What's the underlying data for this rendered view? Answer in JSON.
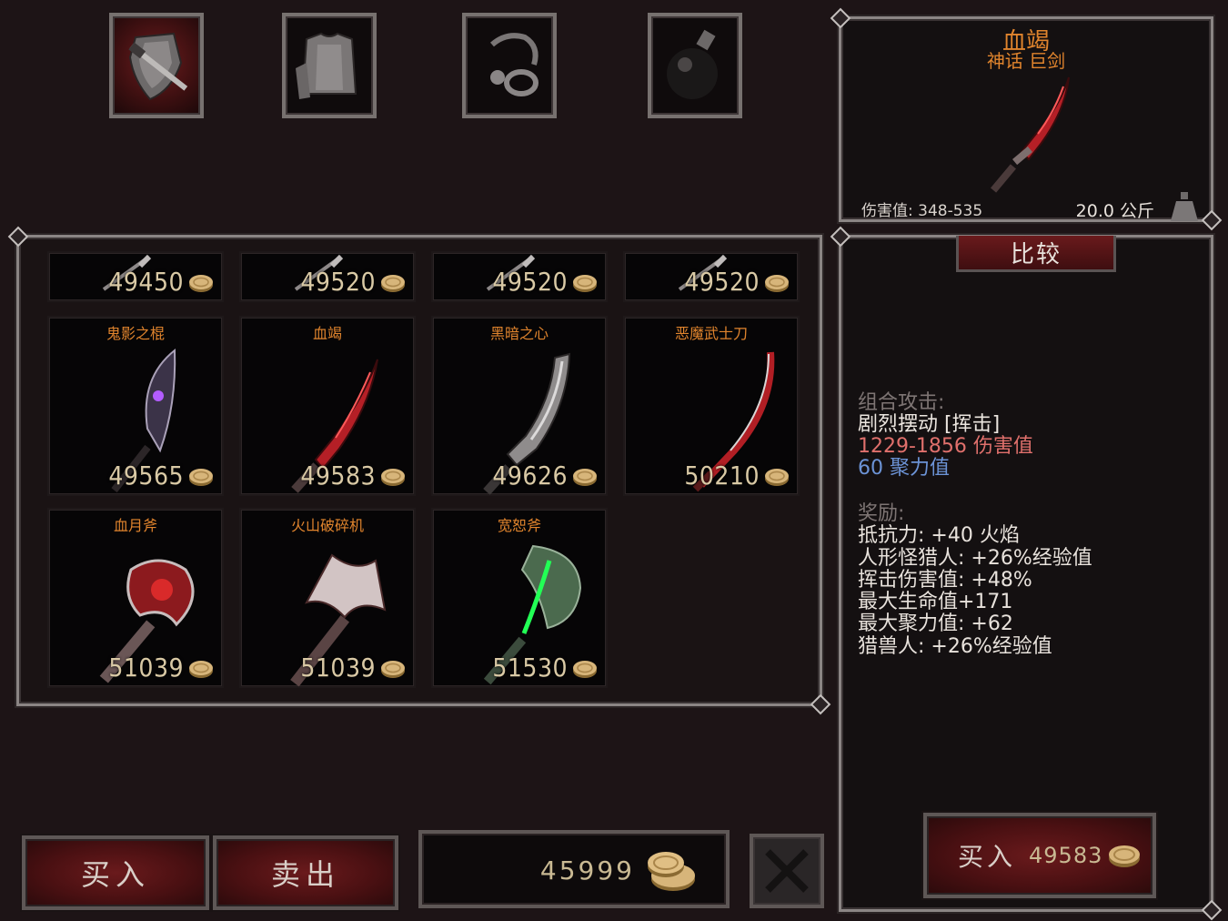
{
  "tabs": [
    {
      "name": "weapons-tab",
      "icon": "sword-shield-icon",
      "active": true
    },
    {
      "name": "armor-tab",
      "icon": "armor-icon",
      "active": false
    },
    {
      "name": "accessories-tab",
      "icon": "ring-amulet-icon",
      "active": false
    },
    {
      "name": "potions-tab",
      "icon": "potion-icon",
      "active": false
    }
  ],
  "items_partial": [
    {
      "price": "49450",
      "icon": "weapon-icon"
    },
    {
      "price": "49520",
      "icon": "weapon-icon"
    },
    {
      "price": "49520",
      "icon": "weapon-icon"
    },
    {
      "price": "49520",
      "icon": "weapon-icon"
    }
  ],
  "items": [
    {
      "name": "鬼影之棍",
      "price": "49565",
      "icon": "ghost-staff-icon"
    },
    {
      "name": "血竭",
      "price": "49583",
      "icon": "blood-sword-icon"
    },
    {
      "name": "黑暗之心",
      "price": "49626",
      "icon": "dark-greatsword-icon"
    },
    {
      "name": "恶魔武士刀",
      "price": "50210",
      "icon": "demon-katana-icon"
    },
    {
      "name": "血月斧",
      "price": "51039",
      "icon": "blood-axe-icon"
    },
    {
      "name": "火山破碎机",
      "price": "51039",
      "icon": "volcano-axe-icon"
    },
    {
      "name": "宽恕斧",
      "price": "51530",
      "icon": "green-axe-icon"
    }
  ],
  "selected": {
    "name": "血竭",
    "type": "神话 巨剑",
    "damage": "伤害值: 348-535",
    "weight": "20.0 公斤"
  },
  "compare_label": "比较",
  "combo": {
    "heading": "组合攻击:",
    "move": "剧烈摆动 [挥击]",
    "damage": "1229-1856 伤害值",
    "focus": "60 聚力值"
  },
  "bonus": {
    "heading": "奖励:",
    "lines": [
      "抵抗力:  +40 火焰",
      "人形怪猎人:  +26%经验值",
      "挥击伤害值:  +48%",
      "最大生命值+171",
      "最大聚力值:  +62",
      "猎兽人:  +26%经验值"
    ]
  },
  "buy_selected": {
    "label": "买入",
    "price": "49583"
  },
  "footer": {
    "buy_label": "买入",
    "sell_label": "卖出",
    "gold": "45999"
  },
  "colors": {
    "accent": "#e0842d",
    "damage": "#e0706c",
    "focus": "#6c93d6",
    "price": "#d9c9a5"
  }
}
